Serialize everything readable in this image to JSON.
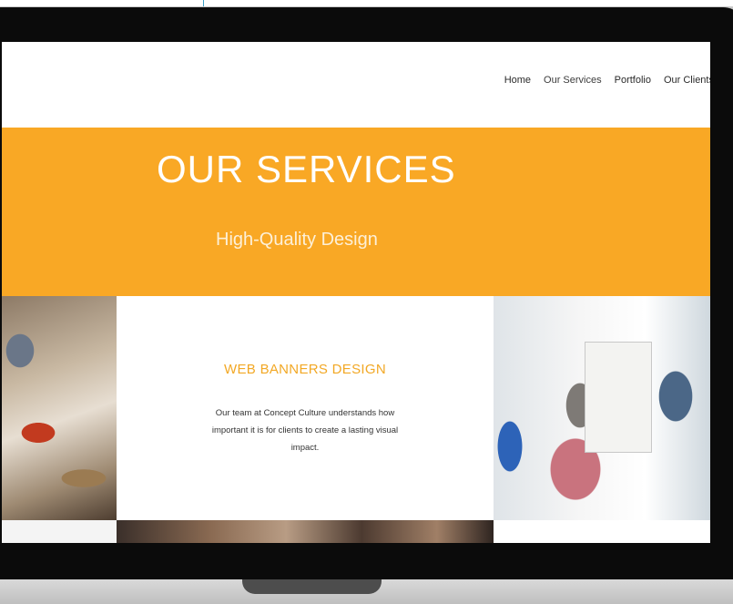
{
  "nav": {
    "items": [
      {
        "label": "Home"
      },
      {
        "label": "Our Services"
      },
      {
        "label": "Portfolio"
      },
      {
        "label": "Our Clients"
      }
    ]
  },
  "hero": {
    "title": "OUR SERVICES",
    "subtitle": "High-Quality Design"
  },
  "service": {
    "title": "WEB BANNERS DESIGN",
    "description": "Our team at Concept Culture understands how important it is for clients to create a lasting visual impact."
  },
  "colors": {
    "accent": "#f9a825",
    "text": "#333333",
    "frame": "#0b0b0b"
  }
}
